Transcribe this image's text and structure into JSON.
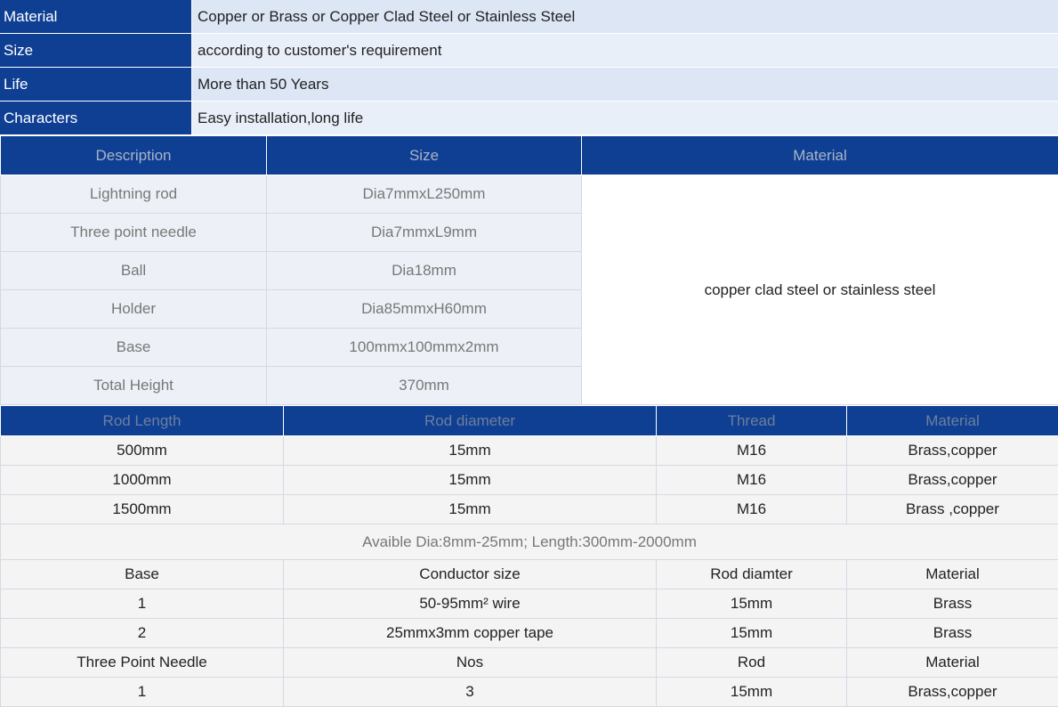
{
  "properties": [
    {
      "label": "Material",
      "value": "Copper or Brass or Copper Clad Steel or Stainless Steel"
    },
    {
      "label": "Size",
      "value": "according to customer's requirement"
    },
    {
      "label": "Life",
      "value": "More than 50 Years"
    },
    {
      "label": "Characters",
      "value": "Easy installation,long life"
    }
  ],
  "components": {
    "headers": [
      "Description",
      "Size",
      "Material"
    ],
    "rows": [
      {
        "description": "Lightning rod",
        "size": "Dia7mmxL250mm"
      },
      {
        "description": "Three point needle",
        "size": "Dia7mmxL9mm"
      },
      {
        "description": "Ball",
        "size": "Dia18mm"
      },
      {
        "description": "Holder",
        "size": "Dia85mmxH60mm"
      },
      {
        "description": "Base",
        "size": "100mmx100mmx2mm"
      },
      {
        "description": "Total Height",
        "size": "370mm"
      }
    ],
    "material": "copper clad steel or stainless steel"
  },
  "rods": {
    "headers": [
      "Rod Length",
      "Rod diameter",
      "Thread",
      "Material"
    ],
    "rows": [
      [
        "500mm",
        "15mm",
        "M16",
        "Brass,copper"
      ],
      [
        "1000mm",
        "15mm",
        "M16",
        "Brass,copper"
      ],
      [
        "1500mm",
        "15mm",
        "M16",
        "Brass ,copper"
      ]
    ],
    "note": "Avaible Dia:8mm-25mm; Length:300mm-2000mm",
    "base_header": [
      "Base",
      "Conductor size",
      "Rod diamter",
      "Material"
    ],
    "base_rows": [
      [
        "1",
        "50-95mm² wire",
        "15mm",
        "Brass"
      ],
      [
        "2",
        "25mmx3mm copper tape",
        "15mm",
        "Brass"
      ]
    ],
    "needle_header": [
      "Three Point Needle",
      "Nos",
      "Rod",
      "Material"
    ],
    "needle_rows": [
      [
        "1",
        "3",
        "15mm",
        "Brass,copper"
      ]
    ]
  }
}
